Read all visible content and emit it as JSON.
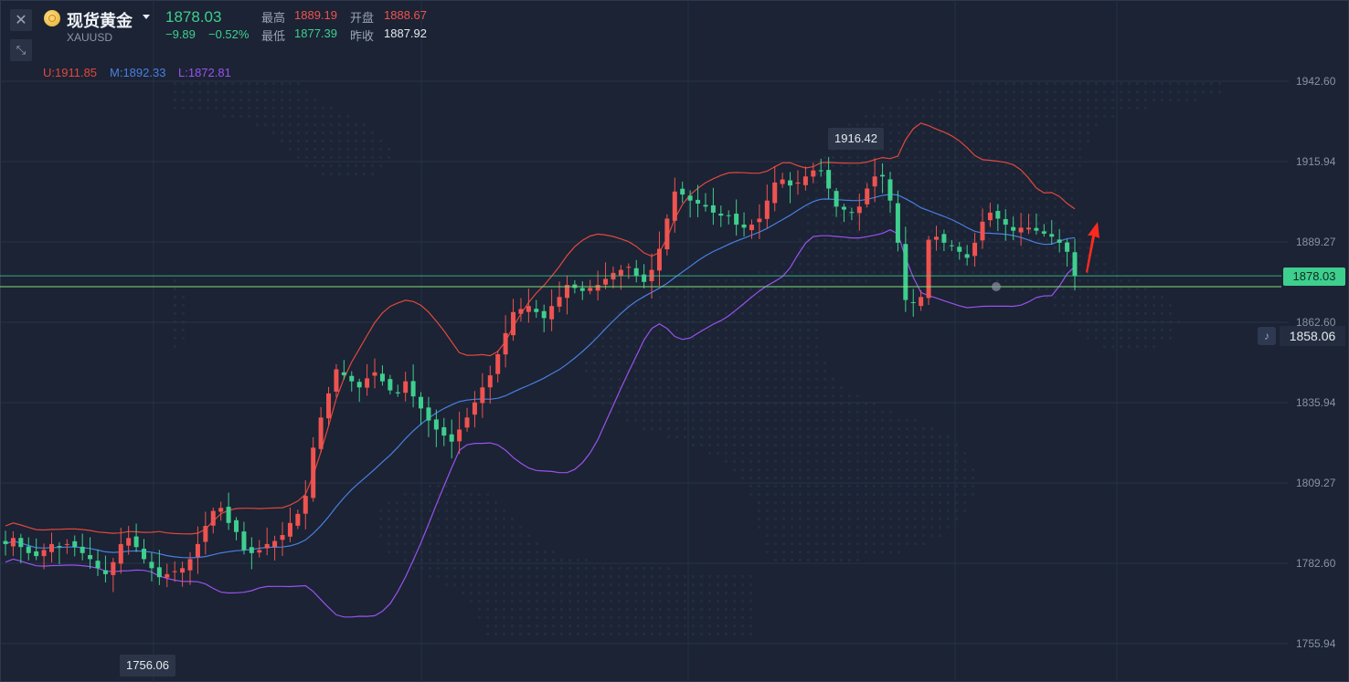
{
  "symbol": {
    "name": "现货黄金",
    "code": "XAUUSD",
    "price": "1878.03",
    "change": "−9.89",
    "change_pct": "−0.52%"
  },
  "quote": {
    "high_label": "最高",
    "high": "1889.19",
    "open_label": "开盘",
    "open": "1888.67",
    "low_label": "最低",
    "low": "1877.39",
    "prev_close_label": "昨收",
    "prev_close": "1887.92"
  },
  "bollinger": {
    "upper": "U:1911.85",
    "middle": "M:1892.33",
    "lower": "L:1872.81",
    "colors": {
      "upper": "#e0483e",
      "middle": "#4a7fe0",
      "lower": "#9a52ee"
    }
  },
  "axis": {
    "ticks": [
      "1942.60",
      "1915.94",
      "1889.27",
      "1862.60",
      "1835.94",
      "1809.27",
      "1782.60",
      "1755.94"
    ]
  },
  "tags": {
    "current_price": "1878.03",
    "alert_price": "1858.06",
    "peak_high": "1916.42",
    "trough_low": "1756.06"
  },
  "icons": {
    "close": "close-icon",
    "collapse": "collapse-arrows-icon",
    "coin": "gold-coin-icon",
    "bell": "bell-icon"
  },
  "colors": {
    "up": "#ef5350",
    "down": "#3ecf8e",
    "background": "#1b2334",
    "grid": "#2a3347"
  },
  "chart_data": {
    "type": "candlestick",
    "y_range": [
      1749,
      1968
    ],
    "y_ticks": [
      1942.6,
      1915.94,
      1889.27,
      1862.6,
      1835.94,
      1809.27,
      1782.6,
      1755.94
    ],
    "current_price": 1878.03,
    "alert_price": 1858.06,
    "bars": 150,
    "close": [
      1789,
      1791,
      1788,
      1786,
      1785,
      1787,
      1789,
      1788,
      1789,
      1788,
      1786,
      1784,
      1781,
      1779,
      1783,
      1789,
      1791,
      1788,
      1784,
      1781,
      1778,
      1779,
      1780,
      1781,
      1784,
      1789,
      1795,
      1800,
      1801,
      1796,
      1793,
      1787,
      1786,
      1787,
      1789,
      1790,
      1792,
      1796,
      1799,
      1805,
      1821,
      1831,
      1839,
      1847,
      1845,
      1843,
      1841,
      1844,
      1846,
      1843,
      1840,
      1839,
      1843,
      1838,
      1834,
      1830,
      1827,
      1825,
      1823,
      1827,
      1831,
      1836,
      1841,
      1845,
      1852,
      1859,
      1866,
      1867,
      1868,
      1866,
      1864,
      1868,
      1871,
      1875,
      1874,
      1873,
      1874,
      1875,
      1877,
      1879,
      1880,
      1881,
      1878,
      1876,
      1880,
      1887,
      1897,
      1906,
      1905,
      1903,
      1902,
      1901,
      1899,
      1898,
      1898,
      1895,
      1894,
      1895,
      1897,
      1903,
      1909,
      1910,
      1908,
      1909,
      1911,
      1913,
      1913,
      1907,
      1901,
      1900,
      1899,
      1901,
      1907,
      1911,
      1911,
      1903,
      1889,
      1870,
      1869,
      1871,
      1890,
      1891,
      1889,
      1888,
      1886,
      1884,
      1889,
      1896,
      1899,
      1897,
      1895,
      1893,
      1894,
      1894,
      1893,
      1892,
      1891,
      1889,
      1886,
      1878
    ],
    "bollinger_upper_final": 1911.85,
    "bollinger_middle_final": 1892.33,
    "bollinger_lower_final": 1872.81,
    "labels": [
      "1916.42",
      "1756.06"
    ]
  }
}
